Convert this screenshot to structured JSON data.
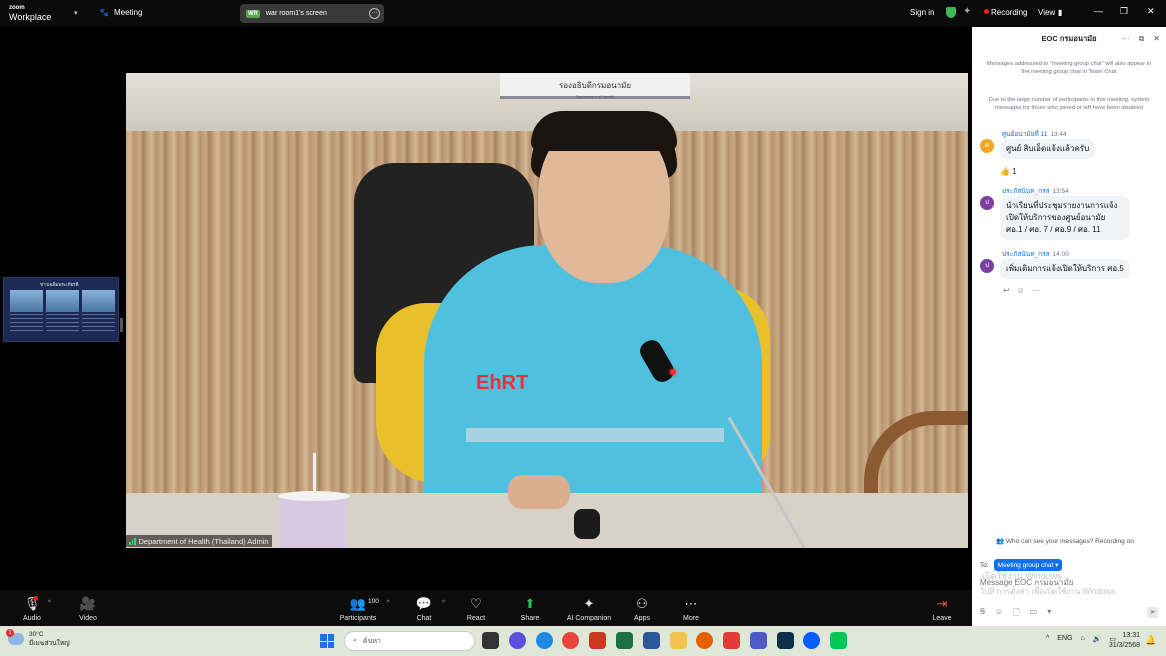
{
  "topbar": {
    "logo_small": "zoom",
    "logo_main": "Workplace",
    "meeting_label": "Meeting",
    "screen_badge": "WR",
    "screen_label": "war room1's screen",
    "signin": "Sign in",
    "recording": "Recording",
    "view": "View"
  },
  "video": {
    "nameplate": "รองอธิบดีกรมอนามัย",
    "nameplate_sub": "Department of Health",
    "vest_logo": "EhRT",
    "speaker_name": "Department of Health (Thailand) Admin"
  },
  "thumbnail": {
    "title": "ข่าวเฉลิมพระเกียรติ"
  },
  "toolbar": {
    "audio": "Audio",
    "video": "Video",
    "participants": "Participants",
    "participants_count": "100",
    "chat": "Chat",
    "react": "React",
    "share": "Share",
    "ai": "AI Companion",
    "apps": "Apps",
    "more": "More",
    "leave": "Leave"
  },
  "chat": {
    "title": "EOC กรมอนามัย",
    "system_1": "Messages addressed to \"meeting group chat\" will also appear in the meeting group chat in Team Chat",
    "system_2": "Due to the large number of participants in this meeting, system messages for those who joined or left have been disabled",
    "messages": [
      {
        "avatar": "ศ",
        "sender": "ศูนย์อนามัยที่ 11",
        "time": "13:44",
        "text": "ศูนย์ สิบเอ็ดแจ้งแล้วครับ",
        "reaction": "👍 1"
      },
      {
        "avatar": "ป",
        "sender": "ประภัสนันท_กรส",
        "time": "13:54",
        "lines": [
          "นำเรียนที่ประชุมรายงานการแจ้ง",
          "เปิดให้บริการของศูนย์อนามัย",
          "ศอ.1 / ศอ. 7 / ศอ.9 / ศอ. 11"
        ]
      },
      {
        "avatar": "ป",
        "sender": "ประภัสนันท_กรส",
        "time": "14:00",
        "text": "เพิ่มเติมการแจ้งเปิดให้บริการ ศอ.5"
      }
    ],
    "who_can_see": "Who can see your messages? Recording on",
    "to_label": "To:",
    "to_target": "Meeting group chat",
    "input_placeholder": "Message EOC กรมอนามัย",
    "watermark_1": "เปิดใช้งาน Windows",
    "watermark_2": "ไปที่ การตั้งค่า เพื่อเปิดใช้งาน Windows"
  },
  "taskbar": {
    "temp": "30°C",
    "weather_desc": "มีเมฆส่วนใหญ่",
    "weather_badge": "1",
    "search": "ค้นหา",
    "lang": "ENG",
    "time": "13:31",
    "date": "31/3/2568"
  },
  "colors": {
    "accent": "#0e72ed",
    "recording": "#e02828",
    "vest": "#4fc1df"
  }
}
